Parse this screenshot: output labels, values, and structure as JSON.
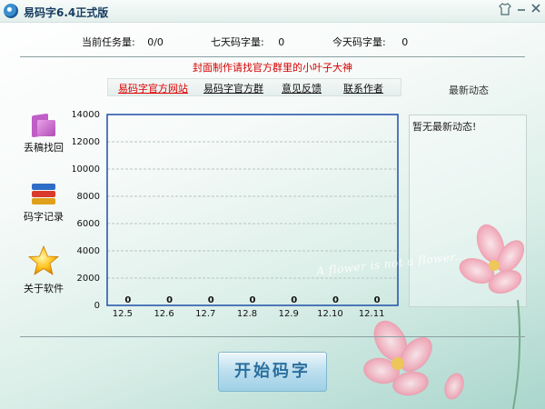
{
  "window": {
    "title": "易码字6.4正式版",
    "shirt_icon": "tshirt-icon",
    "minimize_icon": "minimize-icon",
    "close_icon": "close-icon"
  },
  "stats": {
    "current_tasks_label": "当前任务量:",
    "current_tasks_value": "0/0",
    "seven_day_label": "七天码字量:",
    "seven_day_value": "0",
    "today_label": "今天码字量:",
    "today_value": "0"
  },
  "notice": "封面制作请找官方群里的小叶子大神",
  "links": {
    "official_site": "易码字官方网站",
    "official_group": "易码字官方群",
    "feedback": "意见反馈",
    "contact_author": "联系作者"
  },
  "news": {
    "title": "最新动态",
    "empty_text": "暂无最新动态!"
  },
  "sidebar": [
    {
      "label": "丢稿找回",
      "icon": "folder-icon"
    },
    {
      "label": "码字记录",
      "icon": "books-icon"
    },
    {
      "label": "关于软件",
      "icon": "star-icon"
    }
  ],
  "chart_data": {
    "type": "bar",
    "categories": [
      "12.5",
      "12.6",
      "12.7",
      "12.8",
      "12.9",
      "12.10",
      "12.11"
    ],
    "values": [
      0,
      0,
      0,
      0,
      0,
      0,
      0
    ],
    "title": "",
    "xlabel": "",
    "ylabel": "",
    "ylim": [
      0,
      14000
    ],
    "yticks": [
      0,
      2000,
      4000,
      6000,
      8000,
      10000,
      12000,
      14000
    ],
    "grid": true
  },
  "decoration_text": "A flower is not a flower...",
  "start_button": "开始码字",
  "colors": {
    "notice": "#d40000",
    "link_active": "#e00000",
    "chart_frame": "#1d4fa8",
    "start_text": "#2a6f9e"
  }
}
